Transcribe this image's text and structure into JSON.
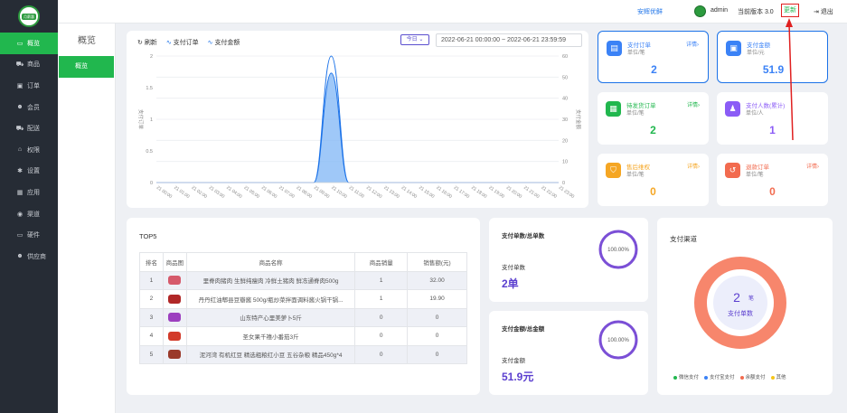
{
  "sidebar": {
    "logo_text": "月薪惠",
    "items": [
      {
        "label": "概览",
        "icon": "monitor-icon"
      },
      {
        "label": "商品",
        "icon": "cart-icon"
      },
      {
        "label": "订单",
        "icon": "order-icon"
      },
      {
        "label": "会员",
        "icon": "members-icon"
      },
      {
        "label": "配送",
        "icon": "truck-icon"
      },
      {
        "label": "权限",
        "icon": "bank-icon"
      },
      {
        "label": "设置",
        "icon": "settings-icon"
      },
      {
        "label": "应用",
        "icon": "apps-icon"
      },
      {
        "label": "渠道",
        "icon": "channel-icon"
      },
      {
        "label": "硬件",
        "icon": "desktop-icon"
      },
      {
        "label": "供应商",
        "icon": "supplier-icon"
      }
    ]
  },
  "subnav": {
    "title": "概览",
    "item": "概览"
  },
  "topbar": {
    "link": "安辉优鲜",
    "user": "admin",
    "version": "当前版本 3.0",
    "update": "更新",
    "logout": "退出"
  },
  "chart": {
    "legend_refresh": "刷新",
    "legend_orders": "支付订单",
    "legend_amount": "支付金额",
    "today": "今日",
    "date_range": "2022-06-21 00:00:00  ~  2022-06-21 23:59:59",
    "ylabel_left": "支付订单",
    "ylabel_right": "支付金额"
  },
  "chart_data": {
    "type": "area",
    "x": [
      "21 00:00",
      "21 01:00",
      "21 02:00",
      "21 03:00",
      "21 04:00",
      "21 05:00",
      "21 06:00",
      "21 07:00",
      "21 08:00",
      "21 09:00",
      "21 10:00",
      "21 11:00",
      "21 12:00",
      "21 13:00",
      "21 14:00",
      "21 15:00",
      "21 16:00",
      "21 17:00",
      "21 18:00",
      "21 19:00",
      "21 20:00",
      "21 21:00",
      "21 22:00",
      "21 23:00"
    ],
    "series": [
      {
        "name": "支付订单",
        "axis": "left",
        "values": [
          0,
          0,
          0,
          0,
          0,
          0,
          0,
          0,
          0,
          0,
          2,
          0,
          0,
          0,
          0,
          0,
          0,
          0,
          0,
          0,
          0,
          0,
          0,
          0
        ]
      },
      {
        "name": "支付金额",
        "axis": "right",
        "values": [
          0,
          0,
          0,
          0,
          0,
          0,
          0,
          0,
          0,
          0,
          51.9,
          0,
          0,
          0,
          0,
          0,
          0,
          0,
          0,
          0,
          0,
          0,
          0,
          0
        ]
      }
    ],
    "yticks_left": [
      "0",
      "0.5",
      "1",
      "1.5",
      "2"
    ],
    "yticks_right": [
      "0",
      "10",
      "20",
      "30",
      "40",
      "50",
      "60"
    ],
    "ylim_left": [
      0,
      2
    ],
    "ylim_right": [
      0,
      60
    ],
    "colors": {
      "orders": "#1b72e8",
      "amount": "#1b72e8",
      "fill": "#7fb6f5"
    }
  },
  "stats": [
    {
      "title": "支付订单",
      "unit": "单位/笔",
      "detail": "详情›",
      "value": "2",
      "color": "#3b82f6",
      "icon": "document-icon"
    },
    {
      "title": "支付金额",
      "unit": "单位/元",
      "detail": "",
      "value": "51.9",
      "color": "#3b82f6",
      "icon": "wallet-icon"
    },
    {
      "title": "待发货订单",
      "unit": "单位/笔",
      "detail": "详情›",
      "value": "2",
      "color": "#21b74e",
      "icon": "package-icon"
    },
    {
      "title": "支付人数(累计)",
      "unit": "单位/人",
      "detail": "",
      "value": "1",
      "color": "#8b5cf6",
      "icon": "people-icon"
    },
    {
      "title": "售后维权",
      "unit": "单位/笔",
      "detail": "详情›",
      "value": "0",
      "color": "#f5a623",
      "icon": "shield-icon"
    },
    {
      "title": "退款订单",
      "unit": "单位/笔",
      "detail": "详情›",
      "value": "0",
      "color": "#f26b4f",
      "icon": "refund-icon"
    }
  ],
  "top5": {
    "title": "TOP5",
    "headers": [
      "排名",
      "商品图",
      "商品名称",
      "商品销量",
      "销售额(元)"
    ],
    "rows": [
      {
        "rank": "1",
        "name": "里脊肉猪肉 生鲜纯瘦肉 冷鲜土猪肉 鲜冻通脊肉500g",
        "qty": "1",
        "amount": "32.00",
        "img": "#d65a6b"
      },
      {
        "rank": "2",
        "name": "丹丹红油郫县豆瓣酱 500g/瓶炒菜拌面调料酱火锅干锅...",
        "qty": "1",
        "amount": "19.90",
        "img": "#b02727"
      },
      {
        "rank": "3",
        "name": "山东特产心里美萝卜5斤",
        "qty": "0",
        "amount": "0",
        "img": "#9c3fbf"
      },
      {
        "rank": "4",
        "name": "圣女果千禧小番茄3斤",
        "qty": "0",
        "amount": "0",
        "img": "#d23a2a"
      },
      {
        "rank": "5",
        "name": "泥河湾 有机红豆 精选粗粮红小豆 五谷杂粮 精品450g*4",
        "qty": "0",
        "amount": "0",
        "img": "#9a3a2a"
      }
    ]
  },
  "pay_orders": {
    "title": "支付单数/总单数",
    "label": "支付单数",
    "value": "2单",
    "ratio": "100.00%",
    "ratio_value": 1.0
  },
  "pay_amount": {
    "title": "支付金额/总金额",
    "label": "支付金额",
    "value": "51.9元",
    "ratio": "100.00%",
    "ratio_value": 1.0
  },
  "channel": {
    "title": "支付渠道",
    "count": "2",
    "count_unit": "笔",
    "center_label": "支付单数",
    "legend": [
      {
        "label": "微信支付",
        "color": "#21b74e"
      },
      {
        "label": "支付宝支付",
        "color": "#3b82f6"
      },
      {
        "label": "余额支付",
        "color": "#f26b4f"
      },
      {
        "label": "其他",
        "color": "#f5c518"
      }
    ]
  }
}
